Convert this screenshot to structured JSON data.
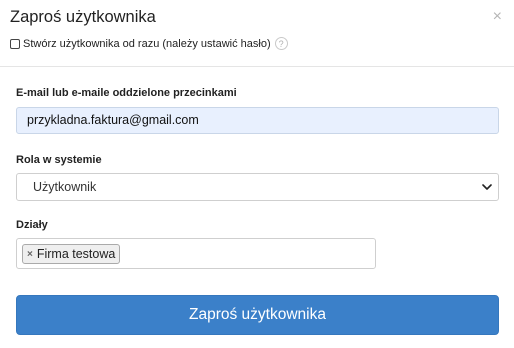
{
  "dialog": {
    "title": "Zaproś użytkownika",
    "close_glyph": "×",
    "create_now_label": "Stwórz użytkownika od razu (należy ustawić hasło)",
    "create_now_checked": false,
    "help_glyph": "?"
  },
  "form": {
    "email": {
      "label": "E-mail lub e-maile oddzielone przecinkami",
      "value": "przykladna.faktura@gmail.com"
    },
    "role": {
      "label": "Rola w systemie",
      "selected": "Użytkownik"
    },
    "departments": {
      "label": "Działy",
      "tags": [
        {
          "remove_glyph": "×",
          "label": "Firma testowa"
        }
      ]
    },
    "submit_label": "Zaproś użytkownika"
  },
  "colors": {
    "primary_button": "#3b80c9",
    "autofill_background": "#e8f0fe"
  },
  "icons": {
    "close": "close-icon",
    "help": "help-icon",
    "select_arrow": "chevron-down-icon",
    "tag_remove": "tag-remove-icon"
  }
}
